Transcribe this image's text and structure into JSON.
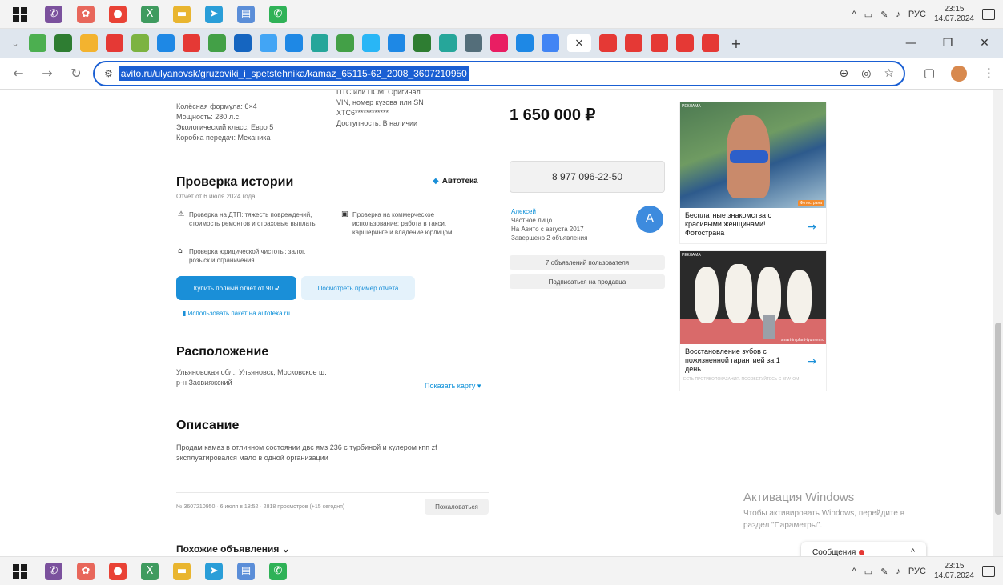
{
  "taskbar": {
    "icons": [
      {
        "name": "viber-icon",
        "color": "#7b519d",
        "glyph": "✆"
      },
      {
        "name": "crystal-icon",
        "color": "#e8675b",
        "glyph": "✿"
      },
      {
        "name": "chrome-icon",
        "color": "#e94235",
        "glyph": "●"
      },
      {
        "name": "excel-icon",
        "color": "#3f9b5f",
        "glyph": "X"
      },
      {
        "name": "file-explorer-icon",
        "color": "#e9b52f",
        "glyph": "▬"
      },
      {
        "name": "telegram-icon",
        "color": "#2a9ed8",
        "glyph": "➤"
      },
      {
        "name": "notes-icon",
        "color": "#5b8ed8",
        "glyph": "▤"
      },
      {
        "name": "whatsapp-icon",
        "color": "#2fb257",
        "glyph": "✆"
      }
    ],
    "tray_lang": "РУС",
    "clock_time": "23:15",
    "clock_date": "14.07.2024"
  },
  "tabstrip": {
    "tab_colors": [
      "#4caf50",
      "#2e7d32",
      "#f3b32f",
      "#e53935",
      "#7cb342",
      "#1e88e5",
      "#e53935",
      "#43a047",
      "#1565c0",
      "#42a5f5",
      "#1e88e5",
      "#26a69a",
      "#43a047",
      "#29b6f6",
      "#1e88e5",
      "#2e7d32",
      "#26a69a",
      "#546e7a",
      "#e91e63",
      "#1e88e5",
      "#4285f4",
      "#e53935",
      "#e53935",
      "#e53935",
      "#e53935",
      "#e53935"
    ],
    "active_glyph": "×",
    "new_tab": "+",
    "minimize": "—",
    "restore": "❐",
    "close": "✕"
  },
  "toolbar": {
    "back": "←",
    "forward": "→",
    "reload": "↻",
    "site_icon": "⚙",
    "url": "avito.ru/ulyanovsk/gruzoviki_i_spetstehnika/kamaz_65115-62_2008_3607210950",
    "zoom": "⊕",
    "eye_off": "◎",
    "star": "☆",
    "tab_search": "▢",
    "menu": "⋮"
  },
  "specs": {
    "left": [
      "Колёсная формула: 6×4",
      "Мощность: 280 л.с.",
      "Экологический класс: Евро 5",
      "Коробка передач: Механика"
    ],
    "right_top": "ПТС или ПСМ: Оригинал",
    "right_vin": "VIN, номер кузова или SN",
    "right_vin_value": "XTC6************",
    "right_avail": "Доступность: В наличии"
  },
  "history": {
    "title": "Проверка истории",
    "subtitle": "Отчет от 6 июля 2024 года",
    "brand": "Автотека",
    "items": [
      "Проверка на ДТП: тяжесть повреждений, стоимость ремонтов и страховые выплаты",
      "Проверка на коммерческое использование: работа в такси, каршеринге и владение юрлицом",
      "Проверка юридической чистоты: залог, розыск и ограничения"
    ],
    "buy_button": "Купить полный отчёт от 90 ₽",
    "example_button": "Посмотреть пример отчёта",
    "package_link": "Использовать пакет на autoteka.ru"
  },
  "location": {
    "title": "Расположение",
    "address_line1": "Ульяновская обл., Ульяновск, Московское ш.",
    "address_line2": "р-н Засвияжский",
    "map_link": "Показать карту ▾"
  },
  "description": {
    "title": "Описание",
    "text_line1": "Продам камаз в отличном состоянии двс ямз 236 с турбиной и кулером кпп zf",
    "text_line2": "эксплуатировался мало в одной организации"
  },
  "footer_meta": {
    "ad_info": "№ 3607210950 · 6 июля в 18:52 · 2818 просмотров (+15 сегодня)",
    "complain": "Пожаловаться"
  },
  "similar": {
    "label": "Похожие объявления ⌄"
  },
  "seller": {
    "price": "1 650 000 ₽",
    "phone": "8 977 096-22-50",
    "name": "Алексей",
    "type": "Частное лицо",
    "since": "На Авито с августа 2017",
    "completed": "Завершено 2 объявления",
    "avatar_letter": "A",
    "ads_button": "7 объявлений пользователя",
    "subscribe_button": "Подписаться на продавца"
  },
  "ads": [
    {
      "label": "РЕКЛАМА",
      "badge": "Фотострана",
      "text": "Бесплатные знакомства с красивыми женщинами! Фотострана",
      "arrow": "→"
    },
    {
      "label": "РЕКЛАМА",
      "badge": "smart-implant-tyumen.ru",
      "text": "Восстановление зубов с пожизненной гарантией за 1 день",
      "arrow": "→",
      "footer": "ЕСТЬ ПРОТИВОПОКАЗАНИЯ. ПОСОВЕТУЙТЕСЬ С ВРАЧОМ"
    }
  ],
  "windows": {
    "activation_title": "Активация Windows",
    "activation_text_1": "Чтобы активировать Windows, перейдите в",
    "activation_text_2": "раздел \"Параметры\"."
  },
  "messages": {
    "label": "Сообщения",
    "chevron": "^"
  }
}
